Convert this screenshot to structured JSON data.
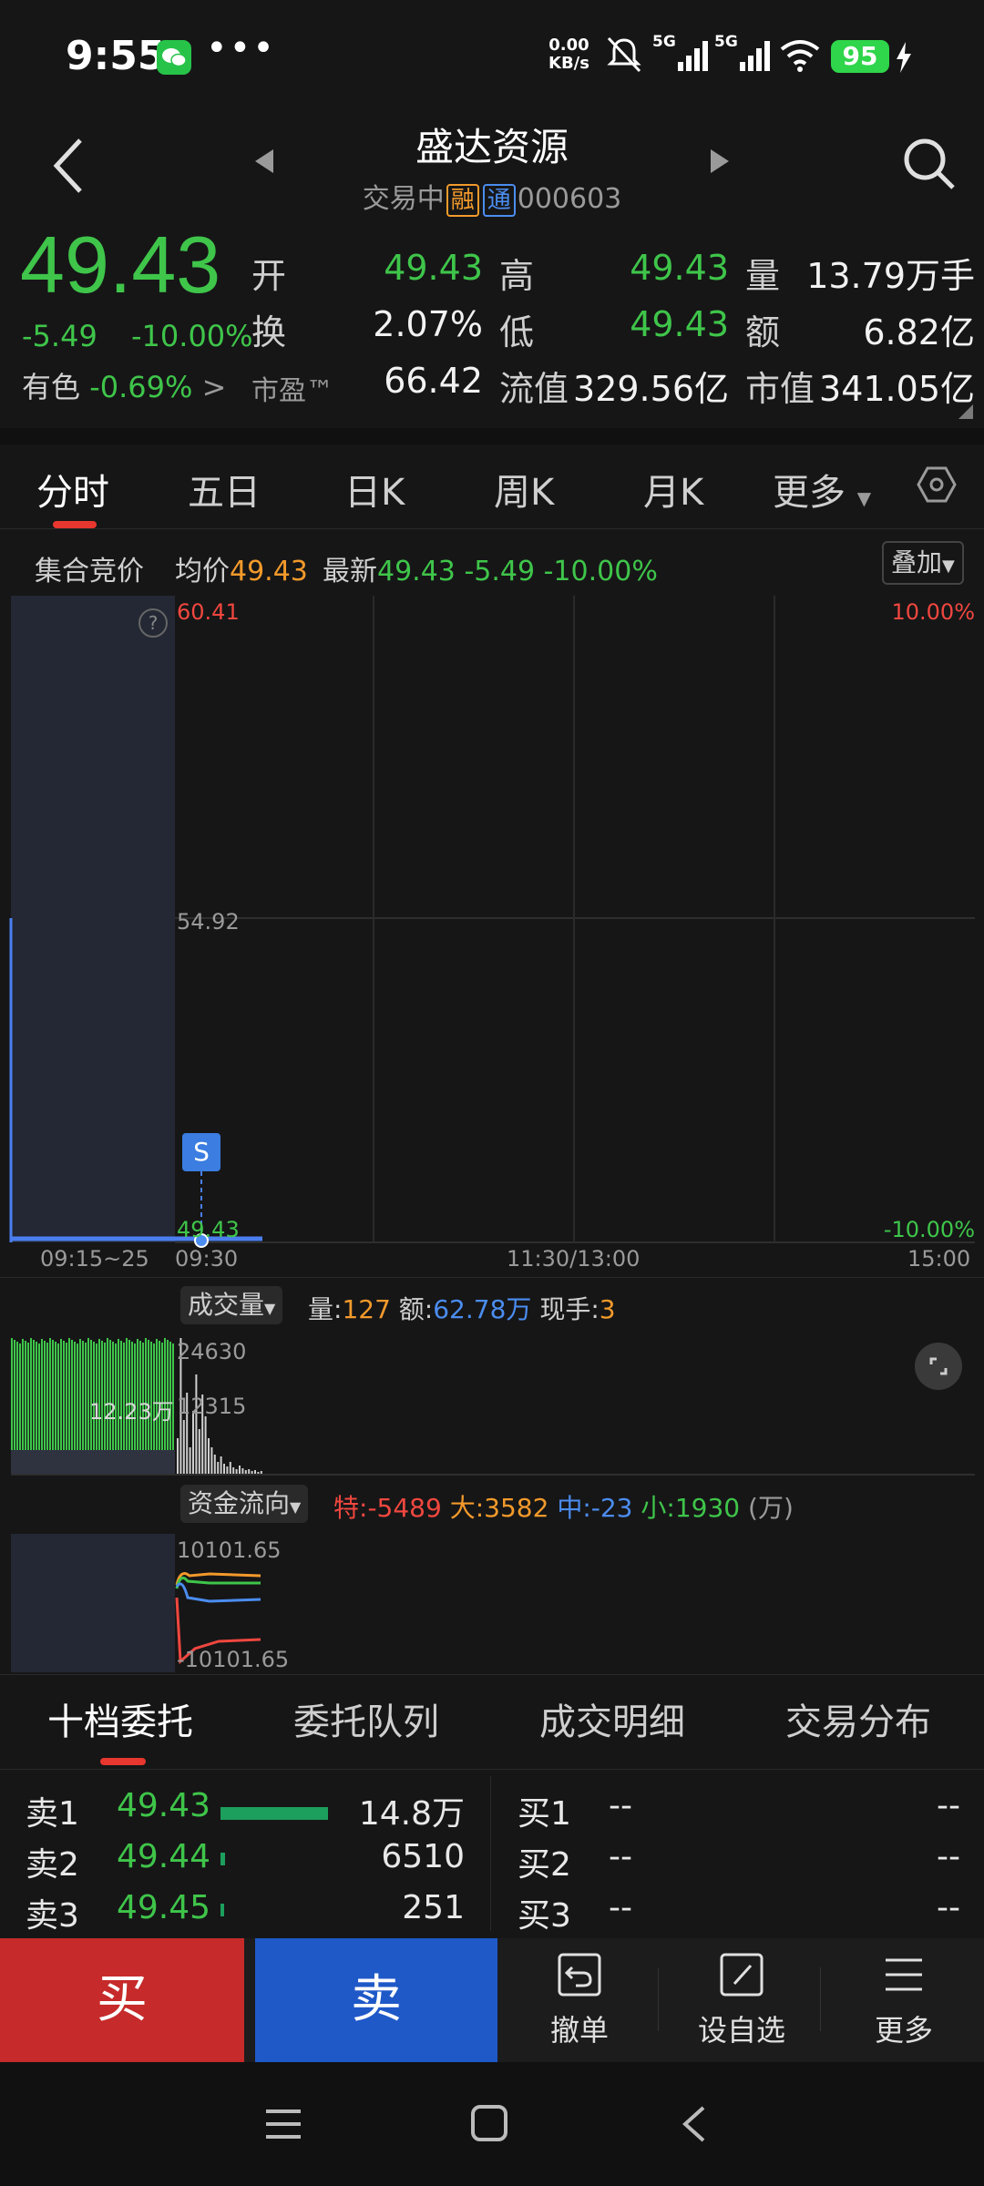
{
  "status_bar": {
    "time": "9:55",
    "dots": "•••",
    "net_speed_value": "0.00",
    "net_speed_unit": "KB/s",
    "signal_1": "5G",
    "signal_2": "5G",
    "battery": "95",
    "icons": [
      "wechat-icon",
      "mute-icon",
      "signal-icon",
      "wifi-icon",
      "charging-icon"
    ]
  },
  "header": {
    "stock_name": "盛达资源",
    "status": "交易中",
    "tag_margin": "融",
    "tag_connect": "通",
    "code": "000603"
  },
  "quote": {
    "price": "49.43",
    "change": "-5.49",
    "change_pct": "-10.00%",
    "sector_name": "有色",
    "sector_pct": "-0.69%",
    "sector_arrow": ">",
    "open_label": "开",
    "open": "49.43",
    "high_label": "高",
    "high": "49.43",
    "volume_label": "量",
    "volume": "13.79万手",
    "turnover_label": "换",
    "turnover": "2.07%",
    "low_label": "低",
    "low": "49.43",
    "amount_label": "额",
    "amount": "6.82亿",
    "pe_label": "市盈™",
    "pe": "66.42",
    "float_cap_label": "流值",
    "float_cap": "329.56亿",
    "mkt_cap_label": "市值",
    "mkt_cap": "341.05亿"
  },
  "tabs": [
    "分时",
    "五日",
    "日K",
    "周K",
    "月K",
    "更多"
  ],
  "info_bar": {
    "auction": "集合竞价",
    "avg_label": "均价",
    "avg": "49.43",
    "last_label": "最新",
    "last": "49.43",
    "last_change": "-5.49",
    "last_pct": "-10.00%",
    "overlay": "叠加"
  },
  "chart": {
    "y_top": "60.41",
    "y_mid": "54.92",
    "y_bottom": "49.43",
    "pct_top": "10.00%",
    "pct_bottom": "-10.00%",
    "marker": "S",
    "help": "?",
    "time_preopen": "09:15~25",
    "time_open": "09:30",
    "time_mid": "11:30/13:00",
    "time_close": "15:00"
  },
  "volume_panel": {
    "selector": "成交量",
    "vol_label": "量:",
    "vol": "127",
    "amt_label": "额:",
    "amt": "62.78万",
    "hand_label": "现手:",
    "hand": "3",
    "y_top": "24630",
    "y_mid": "12315",
    "preopen_total": "12.23万"
  },
  "flow_panel": {
    "selector": "资金流向",
    "super_label": "特:",
    "super": "-5489",
    "large_label": "大:",
    "large": "3582",
    "mid_label": "中:",
    "mid": "-23",
    "small_label": "小:",
    "small": "1930",
    "unit": "(万)",
    "y_top": "10101.65",
    "y_bottom": "-10101.65"
  },
  "order_tabs": [
    "十档委托",
    "委托队列",
    "成交明细",
    "交易分布"
  ],
  "asks": [
    {
      "label": "卖1",
      "price": "49.43",
      "qty": "14.8万",
      "bar": 1.0
    },
    {
      "label": "卖2",
      "price": "49.44",
      "qty": "6510",
      "bar": 0.04
    },
    {
      "label": "卖3",
      "price": "49.45",
      "qty": "251",
      "bar": 0.01
    }
  ],
  "bids": [
    {
      "label": "买1",
      "price": "--",
      "qty": "--"
    },
    {
      "label": "买2",
      "price": "--",
      "qty": "--"
    },
    {
      "label": "买3",
      "price": "--",
      "qty": "--"
    }
  ],
  "actions": {
    "buy": "买",
    "sell": "卖",
    "cancel": "撤单",
    "watchlist": "设自选",
    "more": "更多"
  },
  "colors": {
    "down": "#3fc54a",
    "up": "#f0473f",
    "accent_orange": "#f39a2b",
    "accent_blue": "#4b8df0",
    "buy_bg": "#c62a2a",
    "sell_bg": "#1f59c8"
  }
}
